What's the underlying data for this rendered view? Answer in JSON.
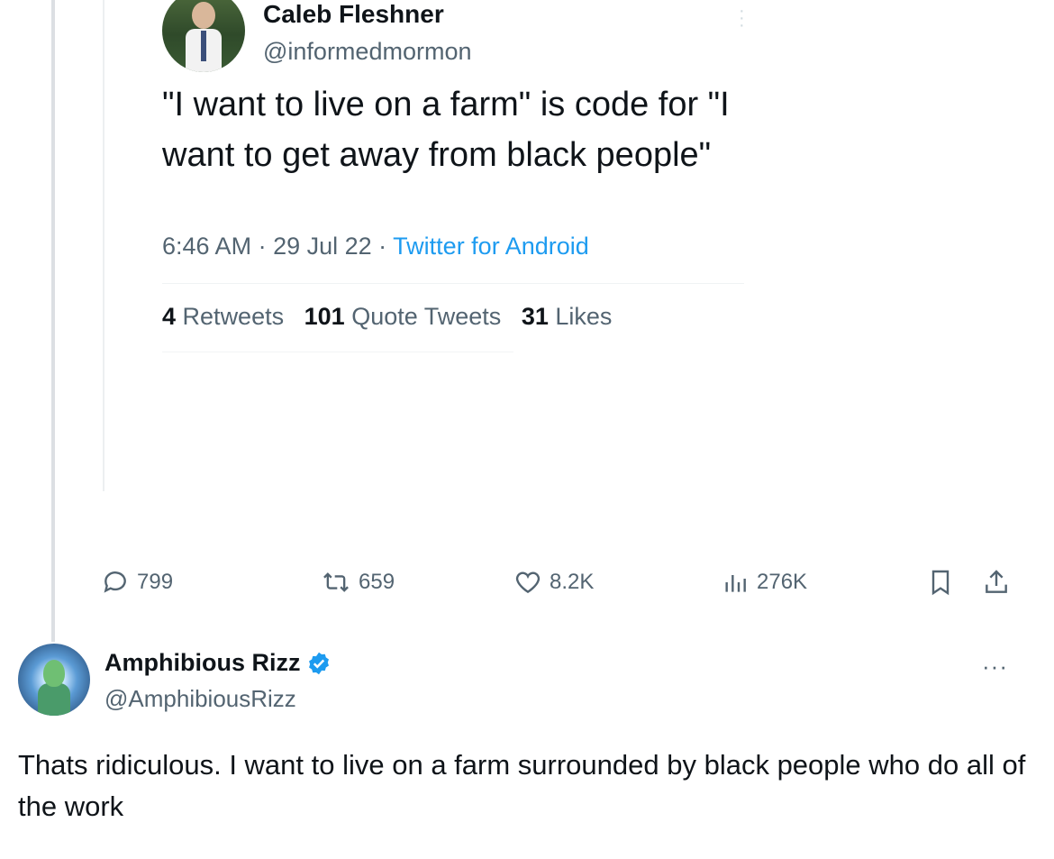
{
  "quoted_tweet": {
    "author_name": "Caleb Fleshner",
    "author_handle": "@informedmormon",
    "text": "\"I want to live on a farm\" is code for \"I want to get away from black people\"",
    "time": "6:46 AM",
    "date": "29 Jul 22",
    "source": "Twitter for Android",
    "separator": " · ",
    "stats": {
      "retweets_count": "4",
      "retweets_label": "Retweets",
      "quotes_count": "101",
      "quotes_label": "Quote Tweets",
      "likes_count": "31",
      "likes_label": "Likes"
    }
  },
  "actions": {
    "replies": "799",
    "reposts": "659",
    "likes": "8.2K",
    "views": "276K"
  },
  "reply": {
    "author_name": "Amphibious Rizz",
    "author_handle": "@AmphibiousRizz",
    "verified": true,
    "text": "Thats ridiculous. I want to live on a farm surrounded by black people who do all of the work",
    "more_label": "···"
  },
  "colors": {
    "text": "#0f1419",
    "secondary": "#536471",
    "link": "#1d9bf0",
    "verified": "#1d9bf0"
  }
}
